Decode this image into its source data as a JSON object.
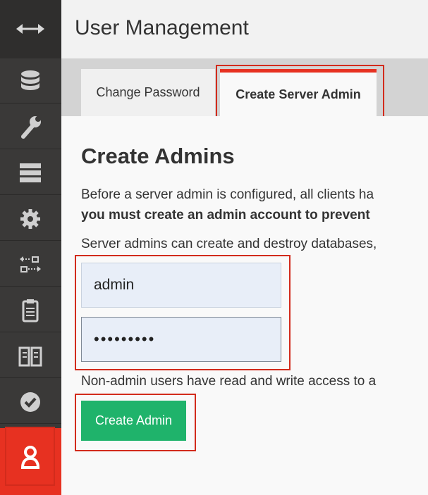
{
  "header": {
    "title": "User Management"
  },
  "tabs": [
    {
      "label": "Change Password",
      "active": false
    },
    {
      "label": "Create Server Admin",
      "active": true
    }
  ],
  "sidebar": {
    "items": [
      {
        "icon": "database-icon"
      },
      {
        "icon": "wrench-icon"
      },
      {
        "icon": "server-icon"
      },
      {
        "icon": "gear-icon"
      },
      {
        "icon": "replication-icon"
      },
      {
        "icon": "clipboard-icon"
      },
      {
        "icon": "book-icon"
      },
      {
        "icon": "check-circle-icon"
      },
      {
        "icon": "user-icon",
        "active": true
      }
    ]
  },
  "main": {
    "heading": "Create Admins",
    "para1": "Before a server admin is configured, all clients ha",
    "para2": "you must create an admin account to prevent",
    "para3": "Server admins can create and destroy databases,",
    "username_value": "admin",
    "password_value": "•••••••••",
    "para4": "Non-admin users have read and write access to a",
    "create_button": "Create Admin"
  },
  "colors": {
    "accent": "#e73121",
    "button": "#1fb36b",
    "sidebar": "#3a3938"
  }
}
